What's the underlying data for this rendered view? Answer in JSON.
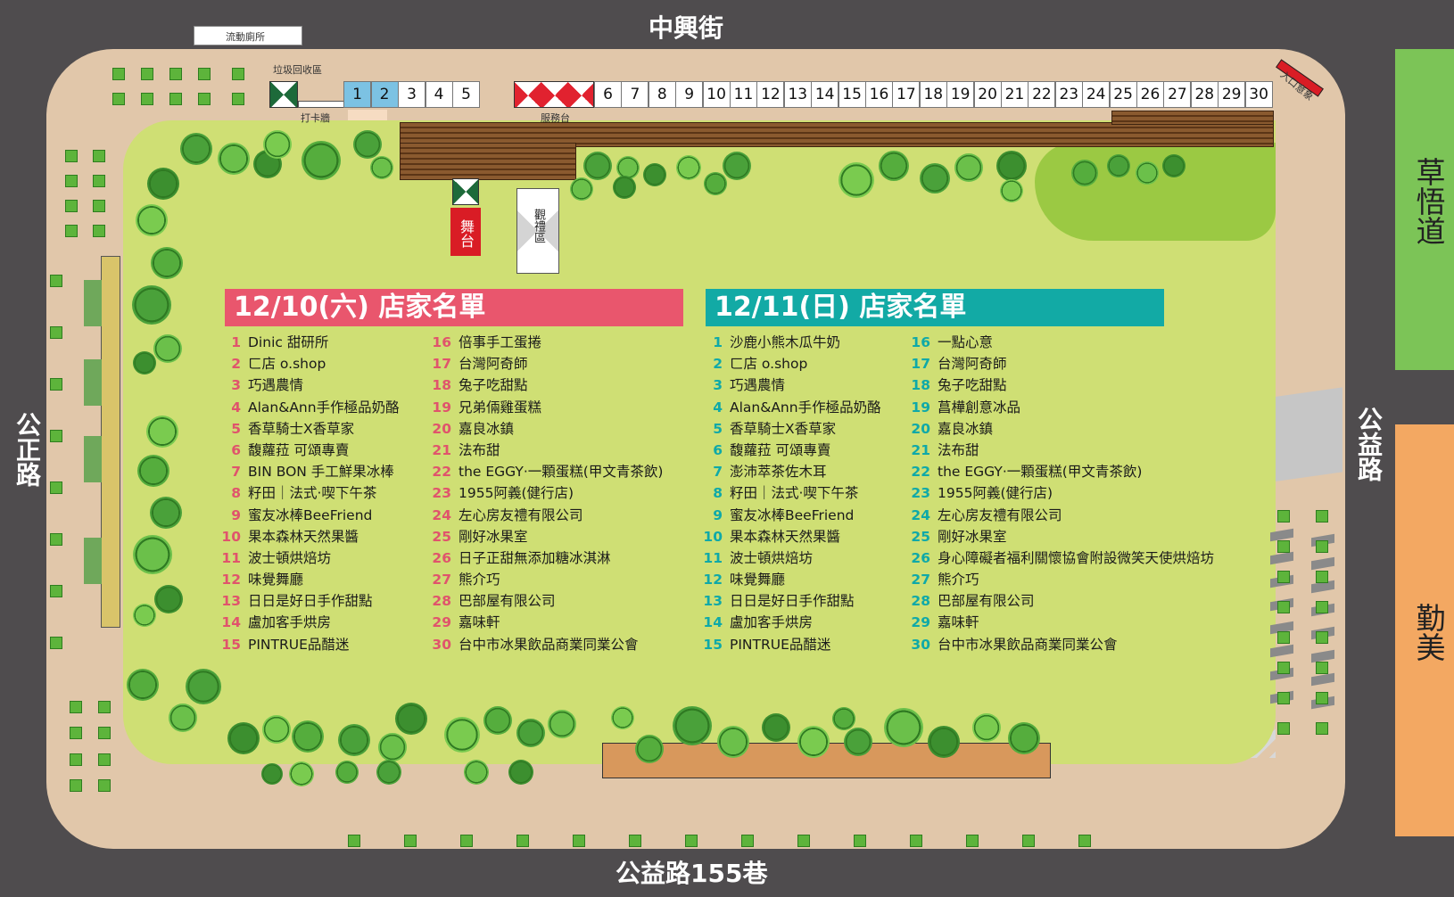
{
  "roads": {
    "top": "中興街",
    "bottom": "公益路155巷",
    "left": "公正路",
    "right": "公益路",
    "right_green": "草悟道",
    "right_orange": "勤美"
  },
  "labels": {
    "toilet": "流動廁所",
    "trash": "垃圾回收區",
    "photo_wall": "打卡牆",
    "service_desk": "服務台",
    "entrance": "入口意象",
    "stage": "舞台",
    "viewing": "觀禮區"
  },
  "booth_numbers": [
    "1",
    "2",
    "3",
    "4",
    "5",
    "6",
    "7",
    "8",
    "9",
    "10",
    "11",
    "12",
    "13",
    "14",
    "15",
    "16",
    "17",
    "18",
    "19",
    "20",
    "21",
    "22",
    "23",
    "24",
    "25",
    "26",
    "27",
    "28",
    "29",
    "30"
  ],
  "colors": {
    "day1": "#e9566d",
    "day2": "#12aaa5",
    "grass": "#cfdf74",
    "plaza": "#e1c7aa",
    "road": "#4f4c4e",
    "green_zone": "#7cc457",
    "orange_zone": "#f3a862"
  },
  "day1": {
    "title": "12/10(六) 店家名單",
    "shops": [
      {
        "n": "1",
        "name": "Dinic 甜研所"
      },
      {
        "n": "2",
        "name": "ㄈ店 o.shop"
      },
      {
        "n": "3",
        "name": "巧遇農情"
      },
      {
        "n": "4",
        "name": "Alan&Ann手作極品奶酪"
      },
      {
        "n": "5",
        "name": "香草騎士X香草家"
      },
      {
        "n": "6",
        "name": "馥蘿菈 可頌專賣"
      },
      {
        "n": "7",
        "name": "BIN BON 手工鮮果冰棒"
      },
      {
        "n": "8",
        "name": "籽田｜法式·喫下午茶"
      },
      {
        "n": "9",
        "name": "蜜友冰棒BeeFriend"
      },
      {
        "n": "10",
        "name": "果本森林天然果醬"
      },
      {
        "n": "11",
        "name": "波士頓烘焙坊"
      },
      {
        "n": "12",
        "name": "味覺舞廳"
      },
      {
        "n": "13",
        "name": "日日是好日手作甜點"
      },
      {
        "n": "14",
        "name": "盧加客手烘房"
      },
      {
        "n": "15",
        "name": "PINTRUE品醋迷"
      },
      {
        "n": "16",
        "name": "倍事手工蛋捲"
      },
      {
        "n": "17",
        "name": "台灣阿奇師"
      },
      {
        "n": "18",
        "name": "兔子吃甜點"
      },
      {
        "n": "19",
        "name": "兄弟倆雞蛋糕"
      },
      {
        "n": "20",
        "name": "嘉良冰鎮"
      },
      {
        "n": "21",
        "name": "法布甜"
      },
      {
        "n": "22",
        "name": "the EGGY·一顆蛋糕(甲文青茶飲)"
      },
      {
        "n": "23",
        "name": "1955阿義(健行店)"
      },
      {
        "n": "24",
        "name": "左心房友禮有限公司"
      },
      {
        "n": "25",
        "name": "剛好冰果室"
      },
      {
        "n": "26",
        "name": "日子正甜無添加糖冰淇淋"
      },
      {
        "n": "27",
        "name": "熊介巧"
      },
      {
        "n": "28",
        "name": "巴部屋有限公司"
      },
      {
        "n": "29",
        "name": "嘉味軒"
      },
      {
        "n": "30",
        "name": "台中市冰果飲品商業同業公會"
      }
    ]
  },
  "day2": {
    "title": "12/11(日) 店家名單",
    "shops": [
      {
        "n": "1",
        "name": "沙鹿小熊木瓜牛奶"
      },
      {
        "n": "2",
        "name": "ㄈ店 o.shop"
      },
      {
        "n": "3",
        "name": "巧遇農情"
      },
      {
        "n": "4",
        "name": "Alan&Ann手作極品奶酪"
      },
      {
        "n": "5",
        "name": "香草騎士X香草家"
      },
      {
        "n": "6",
        "name": "馥蘿菈 可頌專賣"
      },
      {
        "n": "7",
        "name": "澎沛萃茶佐木耳"
      },
      {
        "n": "8",
        "name": "籽田｜法式·喫下午茶"
      },
      {
        "n": "9",
        "name": "蜜友冰棒BeeFriend"
      },
      {
        "n": "10",
        "name": "果本森林天然果醬"
      },
      {
        "n": "11",
        "name": "波士頓烘焙坊"
      },
      {
        "n": "12",
        "name": "味覺舞廳"
      },
      {
        "n": "13",
        "name": "日日是好日手作甜點"
      },
      {
        "n": "14",
        "name": "盧加客手烘房"
      },
      {
        "n": "15",
        "name": "PINTRUE品醋迷"
      },
      {
        "n": "16",
        "name": "一點心意"
      },
      {
        "n": "17",
        "name": "台灣阿奇師"
      },
      {
        "n": "18",
        "name": "兔子吃甜點"
      },
      {
        "n": "19",
        "name": "菖樺創意冰品"
      },
      {
        "n": "20",
        "name": "嘉良冰鎮"
      },
      {
        "n": "21",
        "name": "法布甜"
      },
      {
        "n": "22",
        "name": "the EGGY·一顆蛋糕(甲文青茶飲)"
      },
      {
        "n": "23",
        "name": "1955阿義(健行店)"
      },
      {
        "n": "24",
        "name": "左心房友禮有限公司"
      },
      {
        "n": "25",
        "name": "剛好冰果室"
      },
      {
        "n": "26",
        "name": "身心障礙者福利關懷協會附設微笑天使烘焙坊"
      },
      {
        "n": "27",
        "name": "熊介巧"
      },
      {
        "n": "28",
        "name": "巴部屋有限公司"
      },
      {
        "n": "29",
        "name": "嘉味軒"
      },
      {
        "n": "30",
        "name": "台中市冰果飲品商業同業公會"
      }
    ]
  }
}
